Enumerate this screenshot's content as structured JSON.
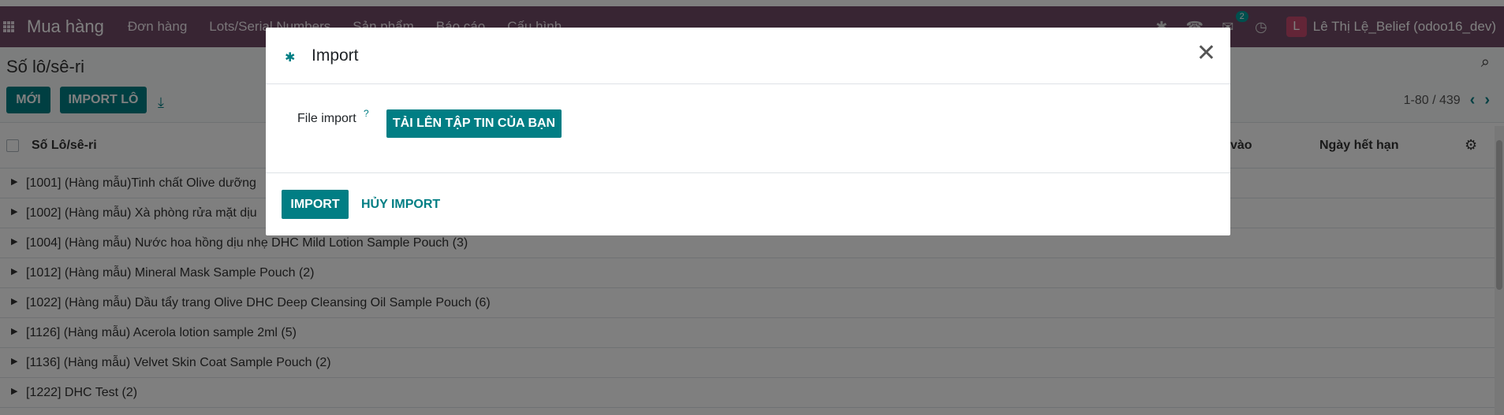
{
  "navbar": {
    "brand": "Mua hàng",
    "menus": [
      "Đơn hàng",
      "Lots/Serial Numbers",
      "Sản phẩm",
      "Báo cáo",
      "Cấu hình"
    ],
    "chat_badge": "2",
    "avatar_letter": "L",
    "user_name": "Lê Thị Lệ_Belief (odoo16_dev)"
  },
  "control": {
    "breadcrumb": "Số lô/sê-ri",
    "new_label": "MỚI",
    "import_lot_label": "IMPORT LÔ",
    "pager": "1-80 / 439"
  },
  "table": {
    "headers": [
      "Số Lô/sê-ri",
      "vào",
      "Ngày hết hạn"
    ],
    "rows": [
      "[1001] (Hàng mẫu)Tinh chất Olive dưỡng",
      "[1002] (Hàng mẫu) Xà phòng rửa mặt dịu",
      "[1004] (Hàng mẫu) Nước hoa hồng dịu nhẹ DHC Mild Lotion Sample Pouch (3)",
      "[1012] (Hàng mẫu) Mineral Mask Sample Pouch (2)",
      "[1022] (Hàng mẫu) Dầu tẩy trang Olive DHC Deep Cleansing Oil Sample Pouch (6)",
      "[1126] (Hàng mẫu) Acerola lotion sample 2ml (5)",
      "[1136] (Hàng mẫu) Velvet Skin Coat Sample Pouch (2)",
      "[1222] DHC Test (2)"
    ]
  },
  "modal": {
    "title": "Import",
    "field_label": "File import",
    "help_mark": "?",
    "upload_label": "TẢI LÊN TẬP TIN CỦA BẠN",
    "import_label": "IMPORT",
    "cancel_label": "HỦY IMPORT"
  }
}
